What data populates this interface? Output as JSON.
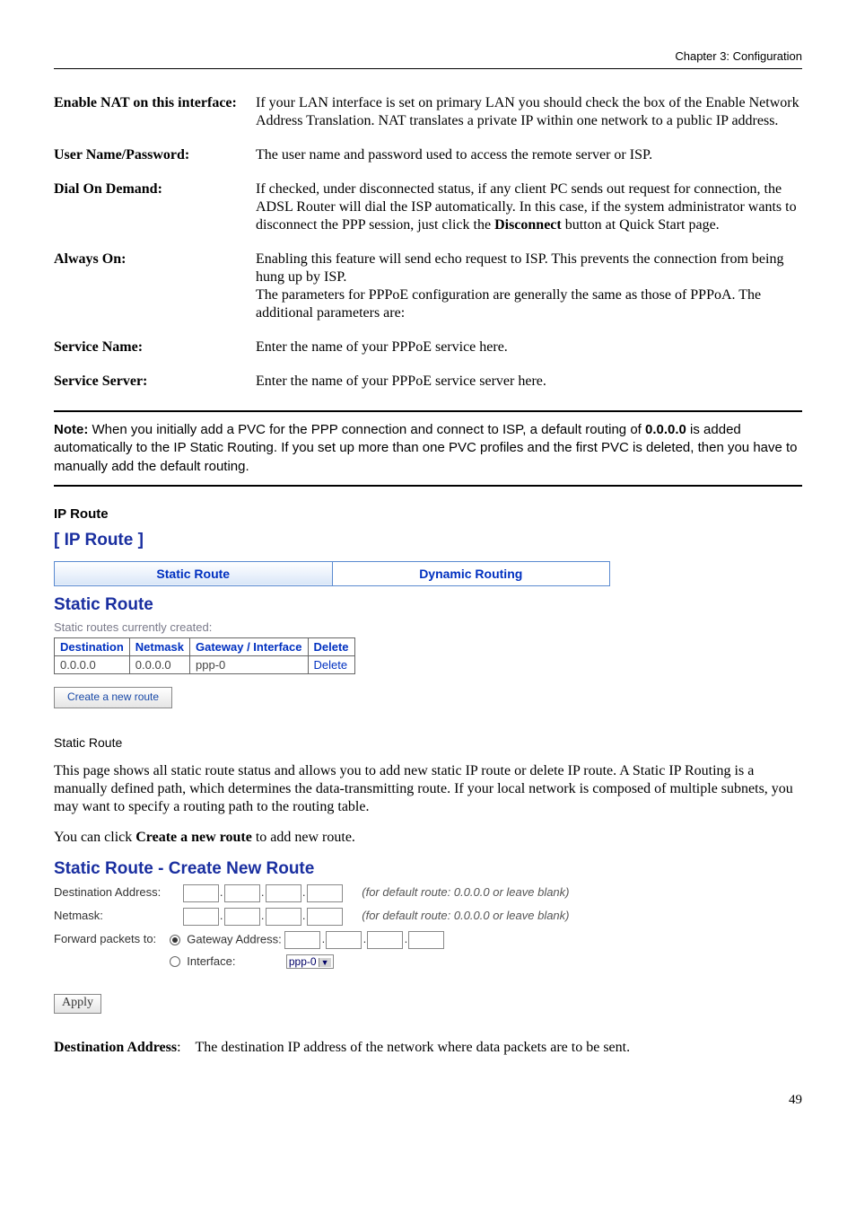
{
  "header": {
    "chapter": "Chapter 3: Configuration"
  },
  "definitions": [
    {
      "term": "Enable NAT on this interface:",
      "desc": "If your LAN interface is set on primary LAN you should check the box of the Enable Network Address Translation. NAT translates a private IP within one network to a public IP address."
    },
    {
      "term": "User Name/Password:",
      "desc": "The user name and password used to access the remote server or ISP."
    },
    {
      "term": "Dial On Demand:",
      "desc": "If checked, under disconnected status, if any client PC sends out request for connection, the ADSL Router will dial the ISP automatically. In this case, if the system administrator wants to disconnect the PPP session, just click the <b>Disconnect</b> button at Quick Start page."
    },
    {
      "term": "Always On:",
      "desc": "Enabling this feature will send echo request to ISP. This prevents the connection from being hung up by ISP.<br>The parameters for PPPoE configuration are generally the same as those of PPPoA. The additional parameters are:"
    },
    {
      "term": "Service Name:",
      "desc": "Enter the name of your PPPoE service here."
    },
    {
      "term": "Service Server:",
      "desc": "Enter the name of your PPPoE service server here."
    }
  ],
  "note": {
    "label": "Note:",
    "text": " When you initially add a PVC for the PPP connection and connect to ISP, a default routing of <b>0.0.0.0</b> is added automatically to the IP Static Routing. If you set up more than one PVC profiles and the first PVC is deleted, then you have to manually add the default routing."
  },
  "iproute": {
    "section_title": "IP Route",
    "header": "[ IP Route ]",
    "tabs": {
      "static": "Static Route",
      "dynamic": "Dynamic Routing"
    },
    "sub_heading": "Static Route",
    "caption": "Static routes currently created:",
    "table": {
      "headers": [
        "Destination",
        "Netmask",
        "Gateway / Interface",
        "Delete"
      ],
      "row": {
        "dest": "0.0.0.0",
        "mask": "0.0.0.0",
        "gw": "ppp-0",
        "del": "Delete"
      }
    },
    "create_btn": "Create a new route"
  },
  "static_route_text": {
    "title": "Static Route",
    "p1": "This page shows all static route status and allows you to add new static IP route or delete IP route. A Static IP Routing is a manually defined path, which determines the data-transmitting route. If your local network is composed of multiple subnets, you may want to specify a routing path to the routing table.",
    "p2_a": "You can click ",
    "p2_bold": "Create a new route",
    "p2_b": " to add new route."
  },
  "create_form": {
    "heading": "Static Route - Create New Route",
    "dest_label": "Destination Address:",
    "netmask_label": "Netmask:",
    "hint": "(for default route: 0.0.0.0 or leave blank)",
    "forward_label": "Forward packets to:",
    "gw_label": "Gateway Address:",
    "iface_label": "Interface:",
    "iface_value": "ppp-0",
    "apply": "Apply"
  },
  "dest_addr_def": {
    "term": "Destination Address",
    "desc": "The destination IP address of the network where data packets are to be sent."
  },
  "page_number": "49"
}
